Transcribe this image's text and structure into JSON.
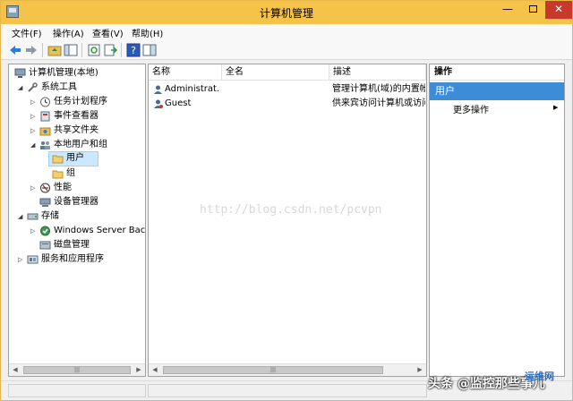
{
  "window": {
    "title": "计算机管理"
  },
  "menubar": {
    "items": [
      "文件(F)",
      "操作(A)",
      "查看(V)",
      "帮助(H)"
    ]
  },
  "tree": {
    "items": [
      {
        "label": "计算机管理(本地)",
        "icon": "computer-icon"
      },
      {
        "label": "系统工具",
        "icon": "tools-icon"
      },
      {
        "label": "任务计划程序",
        "icon": "clock-icon"
      },
      {
        "label": "事件查看器",
        "icon": "event-viewer-icon"
      },
      {
        "label": "共享文件夹",
        "icon": "shared-folder-icon"
      },
      {
        "label": "本地用户和组",
        "icon": "users-icon"
      },
      {
        "label": "用户",
        "icon": "folder-icon"
      },
      {
        "label": "组",
        "icon": "folder-icon"
      },
      {
        "label": "性能",
        "icon": "performance-icon"
      },
      {
        "label": "设备管理器",
        "icon": "device-manager-icon"
      },
      {
        "label": "存储",
        "icon": "storage-icon"
      },
      {
        "label": "Windows Server Back",
        "icon": "backup-icon"
      },
      {
        "label": "磁盘管理",
        "icon": "disk-icon"
      },
      {
        "label": "服务和应用程序",
        "icon": "services-icon"
      }
    ]
  },
  "list": {
    "columns": [
      "名称",
      "全名",
      "描述"
    ],
    "rows": [
      {
        "name": "Administrat...",
        "fullname": "",
        "description": "管理计算机(域)的内置帐"
      },
      {
        "name": "Guest",
        "fullname": "",
        "description": "供来宾访问计算机或访问"
      }
    ]
  },
  "actions": {
    "header": "操作",
    "section": "用户",
    "item": "更多操作"
  },
  "watermark": "http://blog.csdn.net/pcvpn",
  "overlay": {
    "caption": "头条 @监控那些事儿",
    "logo": "运维网"
  }
}
